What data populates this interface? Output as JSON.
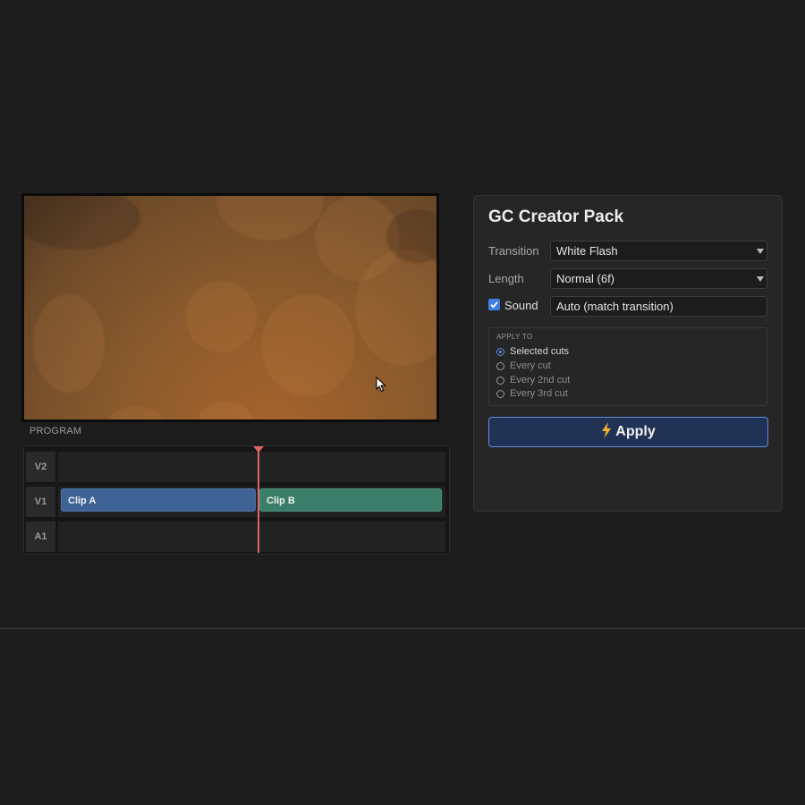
{
  "monitor": {
    "label": "PROGRAM"
  },
  "timeline": {
    "tracks": [
      {
        "name": "V2"
      },
      {
        "name": "V1",
        "clips": [
          "Clip A",
          "Clip B"
        ]
      },
      {
        "name": "A1"
      }
    ],
    "clip_colors": {
      "clip_a": "#3f6395",
      "clip_b": "#3a7e6a",
      "playhead": "#e06464"
    }
  },
  "panel": {
    "title": "GC Creator Pack",
    "transition_label": "Transition",
    "transition_value": "White Flash",
    "length_label": "Length",
    "length_value": "Normal (6f)",
    "sound_label": "Sound",
    "sound_checked": true,
    "sound_value": "Auto (match transition)",
    "apply_to": {
      "legend": "APPLY TO",
      "options": [
        "Selected cuts",
        "Every cut",
        "Every 2nd cut",
        "Every 3rd cut"
      ],
      "selected": "Selected cuts"
    },
    "apply_label": "Apply",
    "apply_icon": "lightning-bolt-icon"
  },
  "colors": {
    "accent": "#5d8ee0",
    "background": "#1d1d1d",
    "panel": "#262626"
  }
}
